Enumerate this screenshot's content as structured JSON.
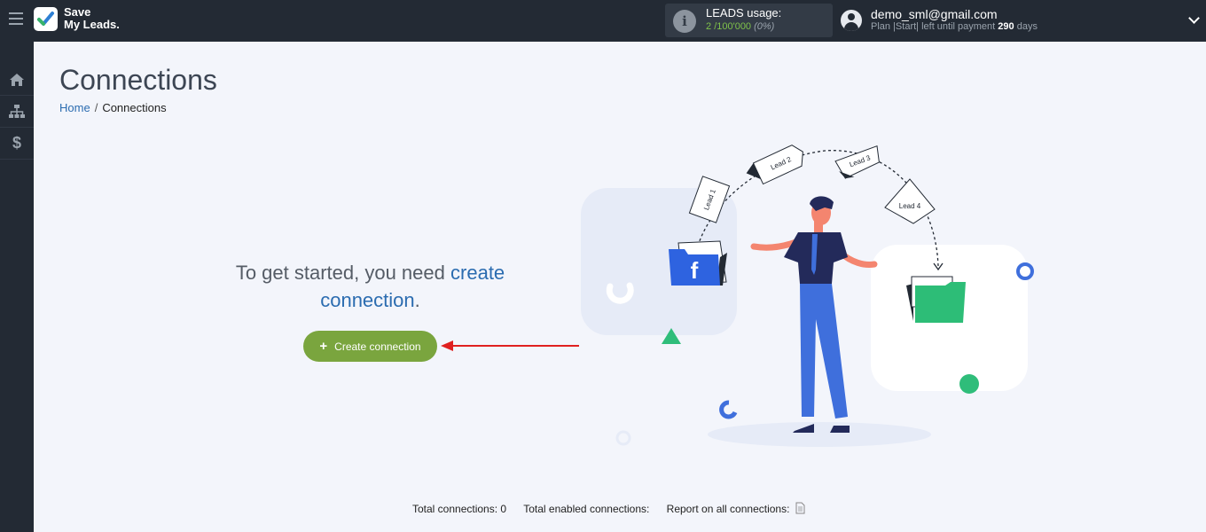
{
  "brand": {
    "line1": "Save",
    "line2": "My Leads."
  },
  "leads_usage": {
    "title": "LEADS usage:",
    "used": "2",
    "total": "/100'000",
    "pct": "(0%)"
  },
  "user": {
    "email": "demo_sml@gmail.com",
    "plan_prefix": "Plan |Start| left until payment",
    "days_value": "290",
    "days_suffix": "days"
  },
  "sidebar": {
    "items": [
      "home-icon",
      "sitemap-icon",
      "dollar-icon"
    ]
  },
  "page": {
    "title": "Connections"
  },
  "breadcrumb": {
    "home": "Home",
    "sep": "/",
    "current": "Connections"
  },
  "intro": {
    "text_before": "To get started, you need",
    "link_part1": "create",
    "link_part2": "connection",
    "period": "."
  },
  "create_button": {
    "plus": "+",
    "label": "Create connection"
  },
  "illustration": {
    "lead1": "Lead 1",
    "lead2": "Lead 2",
    "lead3": "Lead 3",
    "lead4": "Lead 4",
    "fb": "f"
  },
  "footer": {
    "total_label": "Total connections:",
    "total_value": "0",
    "enabled_label": "Total enabled connections:",
    "report_label": "Report on all connections:"
  },
  "colors": {
    "topbar": "#232a34",
    "accent_green": "#7aa53e",
    "link_blue": "#2b6cb0",
    "arrow_red": "#e02020"
  }
}
